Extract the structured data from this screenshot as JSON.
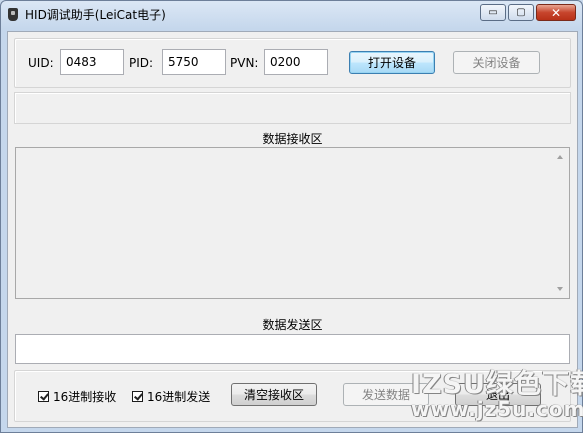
{
  "window": {
    "title": "HID调试助手(LeiCat电子)",
    "caption": {
      "minimize": "▭",
      "maximize": "▢",
      "close": "✕"
    }
  },
  "device": {
    "uid_label": "UID:",
    "uid_value": "0483",
    "pid_label": "PID:",
    "pid_value": "5750",
    "pvn_label": "PVN:",
    "pvn_value": "0200",
    "open_button": "打开设备",
    "close_button": "关闭设备"
  },
  "status": {
    "text": ""
  },
  "receive": {
    "title": "数据接收区",
    "content": ""
  },
  "send": {
    "title": "数据发送区",
    "content": ""
  },
  "controls": {
    "hex_receive_label": "16进制接收",
    "hex_receive_checked": true,
    "hex_send_label": "16进制发送",
    "hex_send_checked": true,
    "clear_button": "清空接收区",
    "send_button": "发送数据",
    "exit_button": "退出"
  },
  "watermark": {
    "line1": "IZSU绿色下载",
    "line2": "www.jz5u.com"
  },
  "colors": {
    "accent": "#3c7fb1",
    "window_frame": "#c5d7ec",
    "client_bg": "#f0f0f0"
  }
}
